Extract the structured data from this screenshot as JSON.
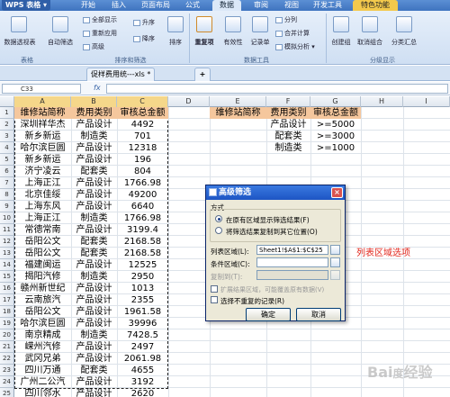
{
  "app": {
    "brand": "WPS 表格"
  },
  "menu_tabs": [
    "开始",
    "插入",
    "页面布局",
    "公式",
    "数据",
    "审阅",
    "视图",
    "开发工具",
    "特色功能"
  ],
  "ribbon": {
    "pivot": "数据透视表",
    "autofilter": "自动筛选",
    "show_all": "全部显示",
    "reapply": "重新应用",
    "advanced": "高级",
    "sort_asc": "升序",
    "sort_desc": "降序",
    "sort": "排序",
    "dedupe": "重复项",
    "validity": "有效性",
    "records": "记录单",
    "split": "分列",
    "merge_calc": "合并计算",
    "what_if": "模拟分析",
    "create_group": "创建组",
    "ungroup": "取消组合",
    "subtotal": "分类汇总",
    "group_sheet": "表格",
    "group_sort": "排序和筛选",
    "group_tools": "数据工具",
    "group_outline": "分级显示"
  },
  "doc": {
    "file_tab": "促样费用统---xls *",
    "new_tab": "+"
  },
  "formula": {
    "cell_ref": "C33",
    "fx": "fx",
    "value": ""
  },
  "columns": [
    "A",
    "B",
    "C",
    "D",
    "E",
    "F",
    "G",
    "H",
    "I"
  ],
  "rows": [
    "1",
    "2",
    "3",
    "4",
    "5",
    "6",
    "7",
    "8",
    "9",
    "10",
    "11",
    "12",
    "13",
    "14",
    "15",
    "16",
    "17",
    "18",
    "19",
    "20",
    "21",
    "22",
    "23",
    "24",
    "25"
  ],
  "table": {
    "headers": [
      "维修站简称",
      "费用类别",
      "审核总金额"
    ],
    "data": [
      [
        "深圳祥华杰",
        "产品设计",
        "4492"
      ],
      [
        "新乡新运",
        "制造类",
        "701"
      ],
      [
        "哈尔滨巨圆",
        "产品设计",
        "12318"
      ],
      [
        "新乡新运",
        "产品设计",
        "196"
      ],
      [
        "济宁凌云",
        "配套类",
        "804"
      ],
      [
        "上海正江",
        "产品设计",
        "1766.98"
      ],
      [
        "北京佳绥",
        "产品设计",
        "49200"
      ],
      [
        "上海东风",
        "产品设计",
        "6640"
      ],
      [
        "上海正江",
        "制造类",
        "1766.98"
      ],
      [
        "常德常南",
        "产品设计",
        "3199.4"
      ],
      [
        "岳阳公文",
        "配套类",
        "2168.58"
      ],
      [
        "岳阳公文",
        "配套类",
        "2168.58"
      ],
      [
        "福建闽运",
        "产品设计",
        "12525"
      ],
      [
        "揭阳汽修",
        "制造类",
        "2950"
      ],
      [
        "赣州新世纪",
        "产品设计",
        "1013"
      ],
      [
        "云南旅汽",
        "产品设计",
        "2355"
      ],
      [
        "岳阳公文",
        "产品设计",
        "1961.58"
      ],
      [
        "哈尔滨巨圆",
        "产品设计",
        "39996"
      ],
      [
        "南京精成",
        "制造类",
        "7428.5"
      ],
      [
        "嵘州汽修",
        "产品设计",
        "2497"
      ],
      [
        "武冈兄弟",
        "产品设计",
        "2061.98"
      ],
      [
        "四川万通",
        "配套类",
        "4655"
      ],
      [
        "广州二公汽",
        "产品设计",
        "3192"
      ],
      [
        "四川邻水",
        "产品设计",
        "2620"
      ]
    ]
  },
  "criteria": {
    "headers": [
      "维修站简称",
      "费用类别",
      "审核总金额"
    ],
    "rows": [
      [
        "",
        "产品设计",
        ">=5000"
      ],
      [
        "",
        "配套类",
        ">=3000"
      ],
      [
        "",
        "制造类",
        ">=1000"
      ]
    ]
  },
  "dialog": {
    "title": "高级筛选",
    "close": "×",
    "method_label": "方式",
    "opt_inplace": "在原有区域显示筛选结果(F)",
    "opt_copy": "将筛选结果复制到其它位置(O)",
    "list_label": "列表区域(L):",
    "list_value": "Sheet1!$A$1:$C$25",
    "criteria_label": "条件区域(C):",
    "criteria_value": "",
    "copy_to_label": "复制到(T):",
    "copy_to_value": "",
    "extend_label": "扩展结果区域，可能覆盖原有数据(V)",
    "unique_label": "选择不重复的记录(R)",
    "ok": "确定",
    "cancel": "取消"
  },
  "annotation": "列表区域选项",
  "watermark": "Bai&#x5EA6;经验"
}
